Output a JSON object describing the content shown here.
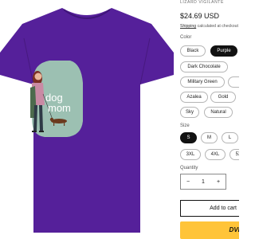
{
  "product": {
    "vendor": "LIZARD VIGILANTE",
    "price": "$24.69 USD",
    "shipping_link": "Shipping",
    "shipping_rest": " calculated at checkout",
    "image_text_line1": "dog",
    "image_text_line2": "mom"
  },
  "color": {
    "label": "Color",
    "selected": "Purple",
    "options": [
      "Black",
      "Purple",
      "Dark Chocolate",
      "Military Green",
      "Azalea",
      "Gold",
      "Sky",
      "Natural"
    ]
  },
  "size": {
    "label": "Size",
    "selected": "S",
    "options": [
      "S",
      "M",
      "L",
      "3XL",
      "4XL",
      "5XL"
    ]
  },
  "quantity": {
    "label": "Quantity",
    "minus": "−",
    "value": "1",
    "plus": "+"
  },
  "buttons": {
    "add_to_cart": "Add to cart",
    "buy_now": "DVE"
  },
  "colors": {
    "shirt": "#55209a",
    "selected_pill": "#121212",
    "buy_button": "#ffc439"
  }
}
